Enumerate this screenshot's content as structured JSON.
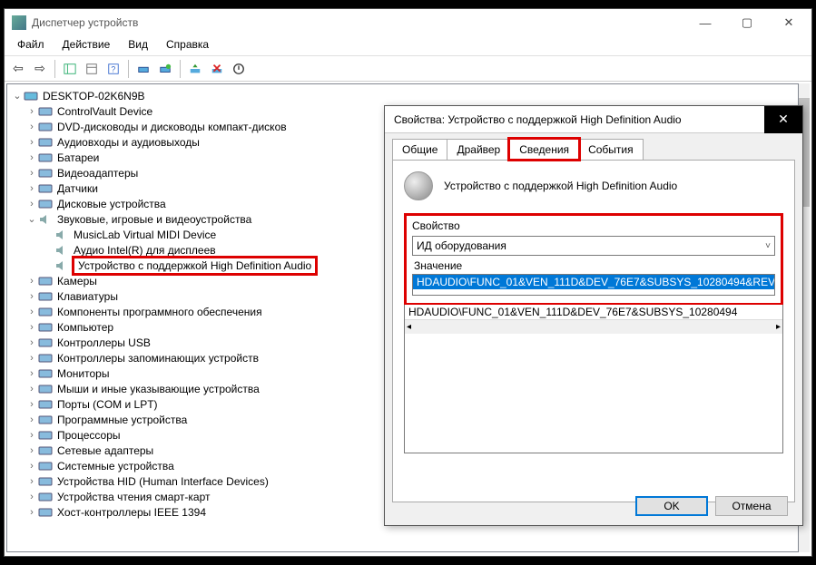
{
  "window": {
    "title": "Диспетчер устройств"
  },
  "menu": {
    "file": "Файл",
    "action": "Действие",
    "view": "Вид",
    "help": "Справка"
  },
  "tree": {
    "root": "DESKTOP-02K6N9B",
    "items": [
      "ControlVault Device",
      "DVD-дисководы и дисководы компакт-дисков",
      "Аудиовходы и аудиовыходы",
      "Батареи",
      "Видеоадаптеры",
      "Датчики",
      "Дисковые устройства"
    ],
    "sound_node": "Звуковые, игровые и видеоустройства",
    "sound_children": [
      "MusicLab Virtual MIDI Device",
      "Аудио Intel(R) для дисплеев",
      "Устройство с поддержкой High Definition Audio"
    ],
    "after": [
      "Камеры",
      "Клавиатуры",
      "Компоненты программного обеспечения",
      "Компьютер",
      "Контроллеры USB",
      "Контроллеры запоминающих устройств",
      "Мониторы",
      "Мыши и иные указывающие устройства",
      "Порты (COM и LPT)",
      "Программные устройства",
      "Процессоры",
      "Сетевые адаптеры",
      "Системные устройства",
      "Устройства HID (Human Interface Devices)",
      "Устройства чтения смарт-карт",
      "Хост-контроллеры IEEE 1394"
    ]
  },
  "dialog": {
    "title": "Свойства: Устройство с поддержкой High Definition Audio",
    "tabs": {
      "general": "Общие",
      "driver": "Драйвер",
      "details": "Сведения",
      "events": "События"
    },
    "device_name": "Устройство с поддержкой High Definition Audio",
    "property_label": "Свойство",
    "property_value": "ИД оборудования",
    "value_label": "Значение",
    "values": [
      "HDAUDIO\\FUNC_01&VEN_111D&DEV_76E7&SUBSYS_10280494&REV",
      "HDAUDIO\\FUNC_01&VEN_111D&DEV_76E7&SUBSYS_10280494"
    ],
    "ok": "OK",
    "cancel": "Отмена"
  }
}
